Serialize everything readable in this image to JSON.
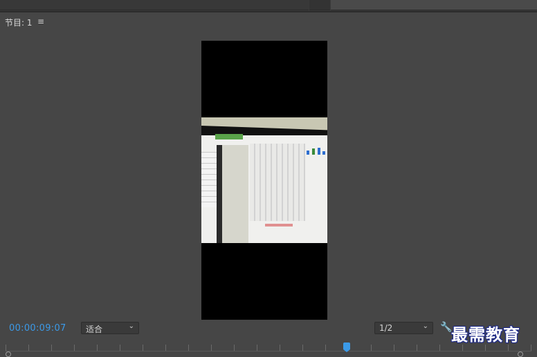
{
  "panel": {
    "title": "节目: 1",
    "menu_icon": "hamburger-menu-icon"
  },
  "playback": {
    "timecode": "00:00:09:07"
  },
  "controls": {
    "fit_select": {
      "value": "适合"
    },
    "resolution_select": {
      "value": "1/2"
    },
    "settings_icon": "wrench-icon"
  },
  "watermark": "最需教育",
  "colors": {
    "background": "#464646",
    "accent": "#3b9ae8",
    "video_letterbox": "#000000"
  }
}
